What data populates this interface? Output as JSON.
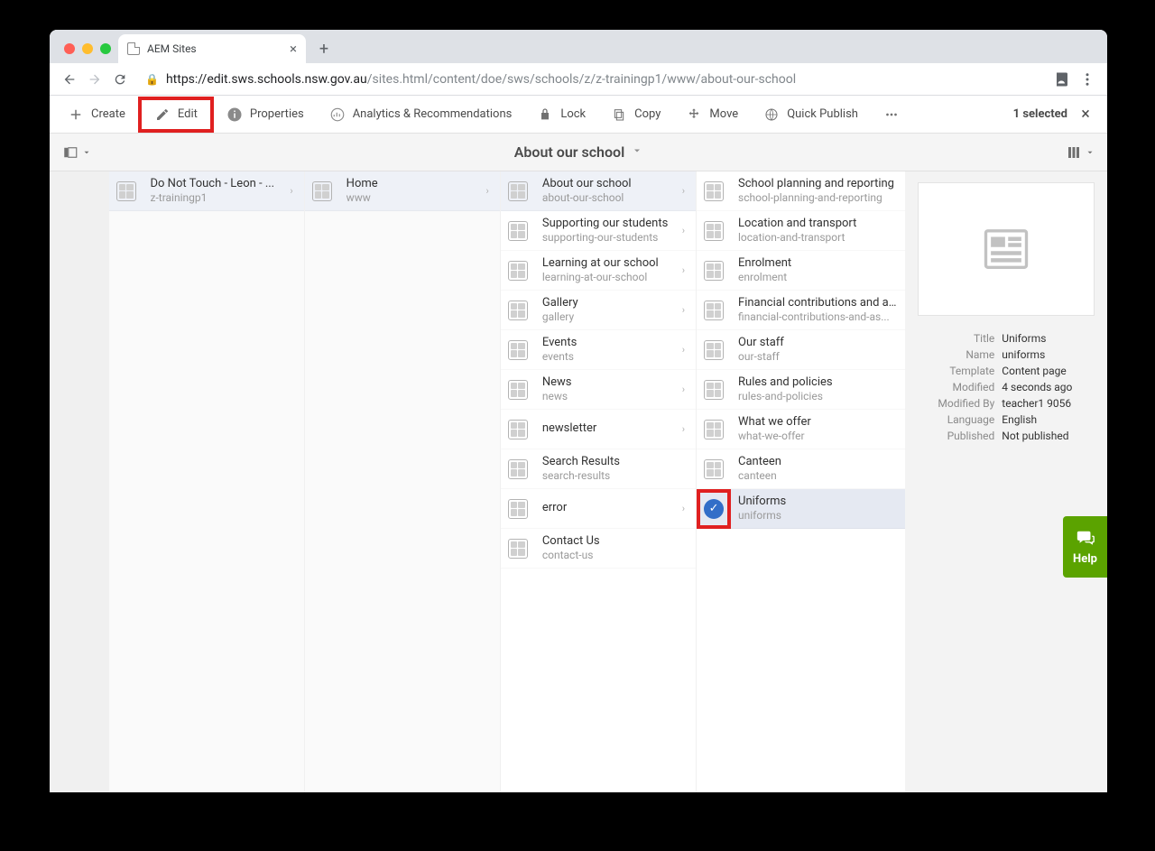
{
  "browser": {
    "tab_title": "AEM Sites",
    "url_host": "https://edit.sws.schools.nsw.gov.au",
    "url_path": "/sites.html/content/doe/sws/schools/z/z-trainingp1/www/about-our-school"
  },
  "toolbar": {
    "create": "Create",
    "edit": "Edit",
    "properties": "Properties",
    "analytics": "Analytics & Recommendations",
    "lock": "Lock",
    "copy": "Copy",
    "move": "Move",
    "publish": "Quick Publish",
    "selected": "1 selected"
  },
  "page_title": "About our school",
  "columns": {
    "col1": [
      {
        "title": "Do Not Touch - Leon - ...",
        "sub": "z-trainingp1",
        "hasChildren": true,
        "active": true
      }
    ],
    "col2": [
      {
        "title": "Home",
        "sub": "www",
        "hasChildren": true,
        "active": true
      }
    ],
    "col3": [
      {
        "title": "About our school",
        "sub": "about-our-school",
        "hasChildren": true,
        "active": true
      },
      {
        "title": "Supporting our students",
        "sub": "supporting-our-students",
        "hasChildren": true
      },
      {
        "title": "Learning at our school",
        "sub": "learning-at-our-school",
        "hasChildren": true
      },
      {
        "title": "Gallery",
        "sub": "gallery",
        "hasChildren": true
      },
      {
        "title": "Events",
        "sub": "events",
        "hasChildren": true
      },
      {
        "title": "News",
        "sub": "news",
        "hasChildren": true
      },
      {
        "title": "newsletter",
        "sub": "",
        "hasChildren": true
      },
      {
        "title": "Search Results",
        "sub": "search-results"
      },
      {
        "title": "error",
        "sub": "",
        "hasChildren": true
      },
      {
        "title": "Contact Us",
        "sub": "contact-us"
      }
    ],
    "col4": [
      {
        "title": "School planning and reporting",
        "sub": "school-planning-and-reporting"
      },
      {
        "title": "Location and transport",
        "sub": "location-and-transport"
      },
      {
        "title": "Enrolment",
        "sub": "enrolment"
      },
      {
        "title": "Financial contributions and as...",
        "sub": "financial-contributions-and-as..."
      },
      {
        "title": "Our staff",
        "sub": "our-staff"
      },
      {
        "title": "Rules and policies",
        "sub": "rules-and-policies"
      },
      {
        "title": "What we offer",
        "sub": "what-we-offer"
      },
      {
        "title": "Canteen",
        "sub": "canteen"
      },
      {
        "title": "Uniforms",
        "sub": "uniforms",
        "selected": true
      }
    ]
  },
  "detail": {
    "labels": {
      "title": "Title",
      "name": "Name",
      "template": "Template",
      "modified": "Modified",
      "modifiedBy": "Modified By",
      "language": "Language",
      "published": "Published"
    },
    "values": {
      "title": "Uniforms",
      "name": "uniforms",
      "template": "Content page",
      "modified": "4 seconds ago",
      "modifiedBy": "teacher1 9056",
      "language": "English",
      "published": "Not published"
    }
  },
  "help": {
    "label": "Help"
  }
}
